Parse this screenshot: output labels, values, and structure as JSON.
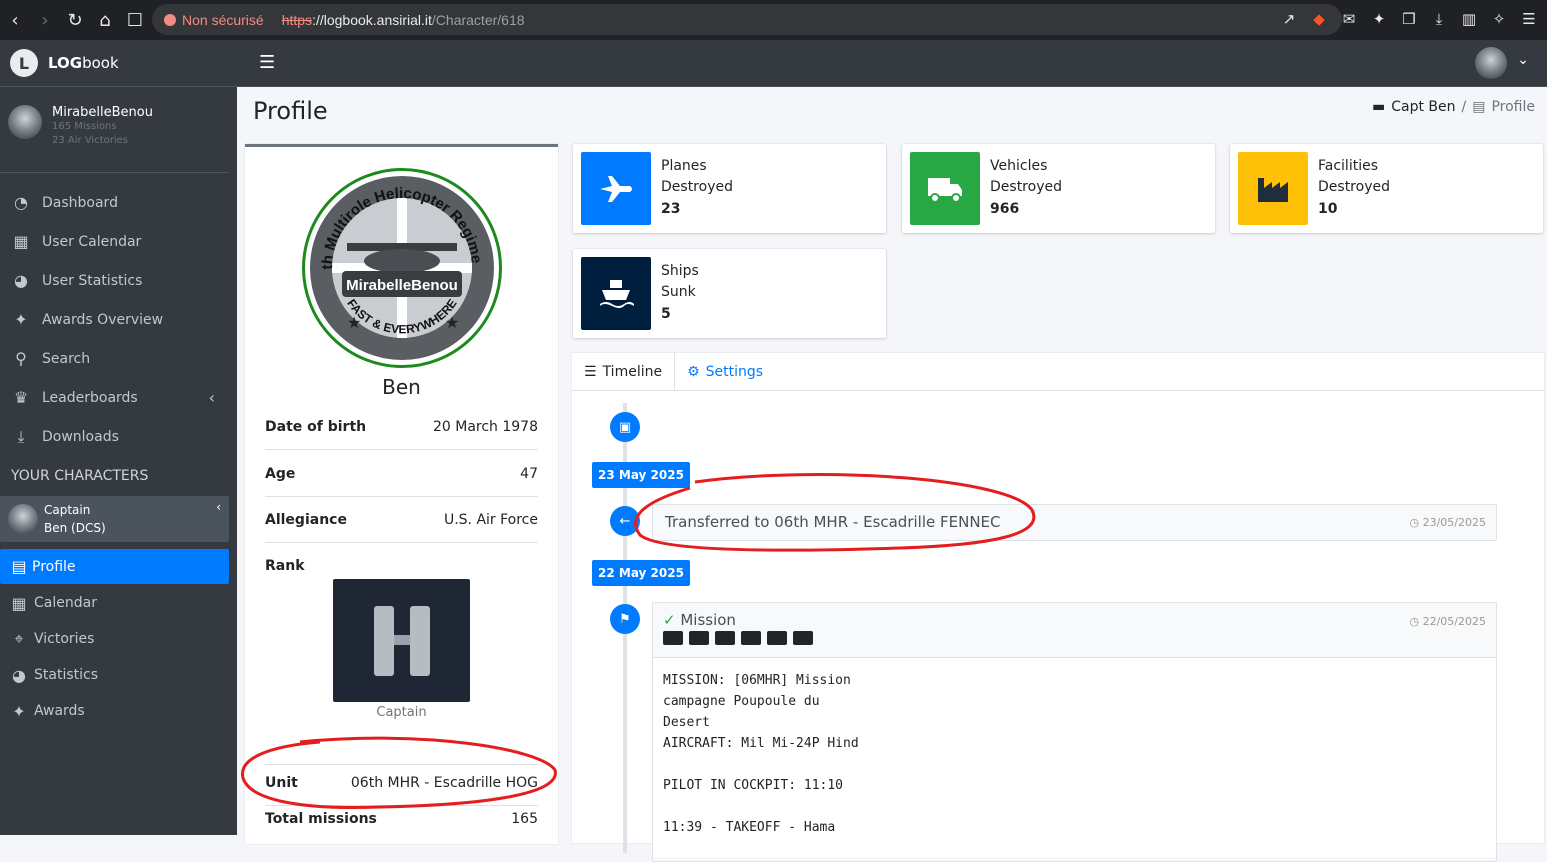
{
  "browser": {
    "security": "Non sécurisé",
    "url_scheme": "https",
    "url_host": "://logbook.ansirial.it",
    "url_path": "/Character/618"
  },
  "brand": {
    "logo": "L",
    "bold": "LOG",
    "rest": "book"
  },
  "user": {
    "name": "MirabelleBenou",
    "missions": "165 Missions",
    "victories": "23 Air Victories"
  },
  "nav": [
    {
      "label": "Dashboard",
      "icon": "dashboard-icon"
    },
    {
      "label": "User Calendar",
      "icon": "calendar-icon"
    },
    {
      "label": "User Statistics",
      "icon": "pie-chart-icon"
    },
    {
      "label": "Awards Overview",
      "icon": "medal-icon"
    },
    {
      "label": "Search",
      "icon": "search-icon"
    },
    {
      "label": "Leaderboards",
      "icon": "trophy-icon"
    },
    {
      "label": "Downloads",
      "icon": "download-icon"
    }
  ],
  "characters_header": "YOUR CHARACTERS",
  "character": {
    "line1": "Captain",
    "line2": "Ben (DCS)"
  },
  "char_nav": [
    {
      "label": "Profile",
      "icon": "id-card-icon"
    },
    {
      "label": "Calendar",
      "icon": "calendar-icon"
    },
    {
      "label": "Victories",
      "icon": "crosshair-icon"
    },
    {
      "label": "Statistics",
      "icon": "pie-chart-icon"
    },
    {
      "label": "Awards",
      "icon": "medal-icon"
    }
  ],
  "page": {
    "title": "Profile"
  },
  "breadcrumb": {
    "first": "Capt Ben",
    "sep": "/",
    "current": "Profile"
  },
  "profile": {
    "name": "Ben",
    "badge_top": "6th Multirole Helicopter Regiment",
    "badge_center": "MirabelleBenou",
    "badge_bottom": "FAST & EVERYWHERE",
    "rows": [
      {
        "k": "Date of birth",
        "v": "20 March 1978"
      },
      {
        "k": "Age",
        "v": "47"
      },
      {
        "k": "Allegiance",
        "v": "U.S. Air Force"
      },
      {
        "k": "Rank",
        "v": ""
      }
    ],
    "rank_caption": "Captain",
    "unit_label": "Unit",
    "unit_value": "06th MHR - Escadrille HOG",
    "missions_label": "Total missions",
    "missions_value": "165"
  },
  "stats": [
    {
      "line1": "Planes",
      "line2": "Destroyed",
      "value": "23",
      "color": "#007bff",
      "icon": "plane-icon"
    },
    {
      "line1": "Vehicles",
      "line2": "Destroyed",
      "value": "966",
      "color": "#28a745",
      "icon": "truck-icon"
    },
    {
      "line1": "Facilities",
      "line2": "Destroyed",
      "value": "10",
      "color": "#ffc107",
      "icon": "industry-icon"
    },
    {
      "line1": "Ships",
      "line2": "Sunk",
      "value": "5",
      "color": "#001f3f",
      "icon": "ship-icon"
    }
  ],
  "tabs": {
    "timeline": "Timeline",
    "settings": "Settings"
  },
  "timeline": {
    "date1": "23 May 2025",
    "event1": "Transferred to 06th MHR - Escadrille FENNEC",
    "event1_time": "23/05/2025",
    "date2": "22 May 2025",
    "event2_title": "Mission",
    "event2_time": "22/05/2025",
    "event2_body": "MISSION: [06MHR] Mission\ncampagne Poupoule du\nDesert\nAIRCRAFT: Mil Mi-24P Hind\n\nPILOT IN COCKPIT: 11:10\n\n11:39 - TAKEOFF - Hama"
  }
}
